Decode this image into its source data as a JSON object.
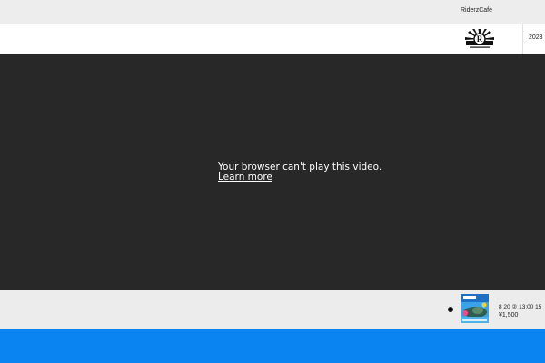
{
  "topbar": {
    "link": "RiderzCafe"
  },
  "header": {
    "year": "2023"
  },
  "video": {
    "message": "Your browser can't play this video.",
    "learn_more": "Learn more"
  },
  "event": {
    "date": "8 20  ②    13:00 15",
    "price": "¥1,500"
  },
  "colors": {
    "topbar": "#ededed",
    "video_bg": "#282828",
    "event_bar": "#ececec",
    "bottom_bar": "#0a84f0"
  },
  "icons": {
    "logo": "sunburst-r-logo",
    "bullet": "dot-icon"
  }
}
